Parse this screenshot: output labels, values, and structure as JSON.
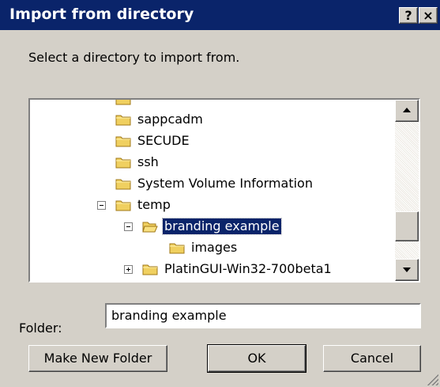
{
  "window": {
    "title": "Import from directory",
    "help_label": "?",
    "close_label": "×"
  },
  "prompt": "Select a directory to import from.",
  "tree": {
    "items": [
      {
        "label": "sappcadm"
      },
      {
        "label": "SECUDE"
      },
      {
        "label": "ssh"
      },
      {
        "label": "System Volume Information"
      },
      {
        "label": "temp"
      },
      {
        "label": "branding example",
        "selected": true
      },
      {
        "label": "images"
      },
      {
        "label": "PlatinGUI-Win32-700beta1"
      }
    ]
  },
  "folder": {
    "label": "Folder:",
    "value": "branding example"
  },
  "buttons": {
    "new_folder": "Make New Folder",
    "ok": "OK",
    "cancel": "Cancel"
  },
  "colors": {
    "titlebar": "#0a246a",
    "selection": "#0a246a",
    "face": "#d4d0c8",
    "folder": "#f0d060"
  },
  "icons": [
    "folder-icon",
    "expand-icon",
    "collapse-icon",
    "scroll-up-icon",
    "scroll-down-icon",
    "resize-grip-icon"
  ]
}
